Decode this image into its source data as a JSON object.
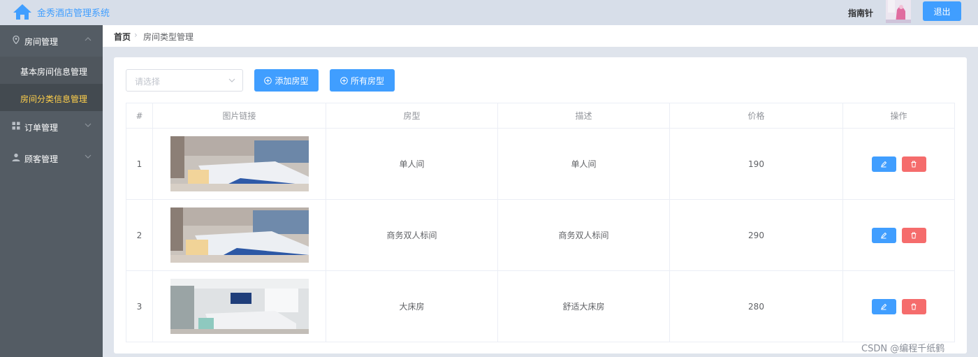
{
  "header": {
    "app_title": "金秀酒店管理系统",
    "user_name": "指南针",
    "logout_label": "退出"
  },
  "sidebar": {
    "groups": [
      {
        "label": "房间管理",
        "icon": "location-icon"
      },
      {
        "label": "订单管理",
        "icon": "grid-icon"
      },
      {
        "label": "顾客管理",
        "icon": "user-icon"
      }
    ],
    "sub_items": [
      {
        "label": "基本房间信息管理",
        "active": false
      },
      {
        "label": "房间分类信息管理",
        "active": true
      }
    ]
  },
  "breadcrumb": {
    "home": "首页",
    "current": "房间类型管理"
  },
  "toolbar": {
    "select_placeholder": "请选择",
    "add_label": "添加房型",
    "all_label": "所有房型"
  },
  "table": {
    "headers": [
      "#",
      "图片链接",
      "房型",
      "描述",
      "价格",
      "操作"
    ],
    "rows": [
      {
        "index": "1",
        "type": "单人间",
        "desc": "单人间",
        "price": "190"
      },
      {
        "index": "2",
        "type": "商务双人标间",
        "desc": "商务双人标间",
        "price": "290"
      },
      {
        "index": "3",
        "type": "大床房",
        "desc": "舒适大床房",
        "price": "280"
      }
    ]
  },
  "watermark": "CSDN @编程千纸鹤",
  "colors": {
    "primary": "#409eff",
    "danger": "#f56c6c",
    "sidebar": "#545c64",
    "active_text": "#ffd04b"
  }
}
